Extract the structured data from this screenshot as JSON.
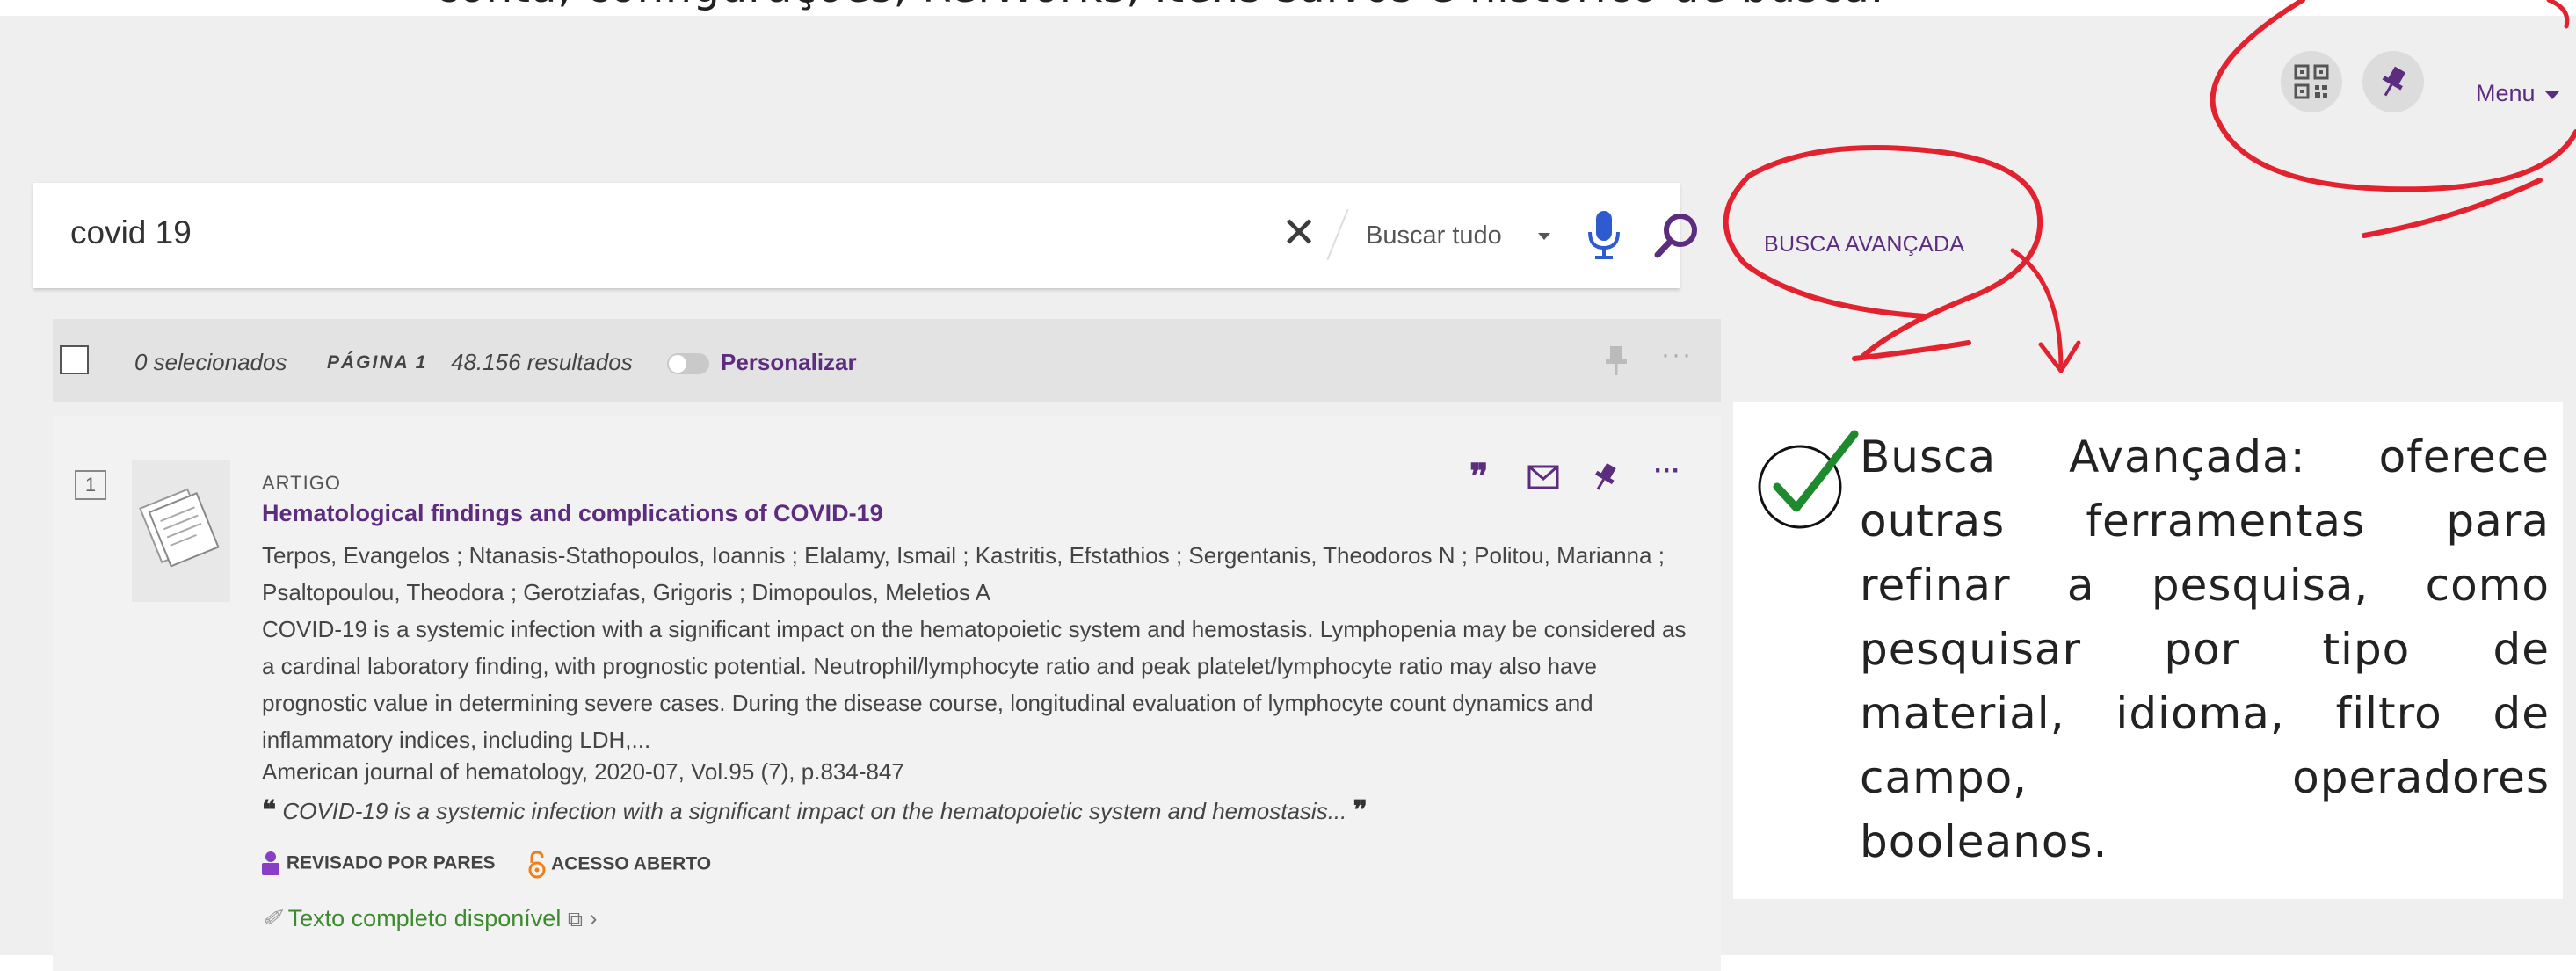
{
  "overlay_top_text": "conta, configurações, RefWorks, itens salvos e histórico de busca.",
  "header": {
    "menu_label": "Menu",
    "qr_icon": "qr-code-icon",
    "pin_icon": "pushpin-icon"
  },
  "search": {
    "value": "covid 19",
    "clear_symbol": "✕",
    "scope": "Buscar tudo",
    "advanced_link": "BUSCA AVANÇADA"
  },
  "results_header": {
    "selected": "0 selecionados",
    "page": "PÁGINA 1",
    "count": "48.156 resultados",
    "personalize": "Personalizar"
  },
  "result": {
    "number": "1",
    "type": "ARTIGO",
    "title": "Hematological findings and complications of COVID-19",
    "authors": "Terpos, Evangelos ; Ntanasis-Stathopoulos, Ioannis ; Elalamy, Ismail ; Kastritis, Efstathios ; Sergentanis, Theodoros N ; Politou, Marianna ; Psaltopoulou, Theodora ; Gerotziafas, Grigoris ; Dimopoulos, Meletios A",
    "abstract": "COVID-19 is a systemic infection with a significant impact on the hematopoietic system and hemostasis. Lymphopenia may be considered as a cardinal laboratory finding, with prognostic potential. Neutrophil/lymphocyte ratio and peak platelet/lymphocyte ratio may also have prognostic value in determining severe cases. During the disease course, longitudinal evaluation of lymphocyte count dynamics and inflammatory indices, including LDH,...",
    "source": "American journal of hematology, 2020-07, Vol.95 (7), p.834-847",
    "snippet": "COVID-19 is a systemic infection with a significant impact on the hematopoietic system and hemostasis...",
    "badge_peer": "REVISADO POR PARES",
    "badge_open": "ACESSO ABERTO",
    "fulltext": "Texto completo disponível"
  },
  "callout": {
    "text": "Busca Avançada: oferece outras ferramentas para refinar a pesquisa, como pesquisar por tipo de material, idioma, filtro de campo, operadores booleanos."
  },
  "colors": {
    "brand_purple": "#5c2d7e",
    "annotation_red": "#e2232f",
    "check_green": "#1e8a2e",
    "fulltext_green": "#3d8a2f"
  }
}
